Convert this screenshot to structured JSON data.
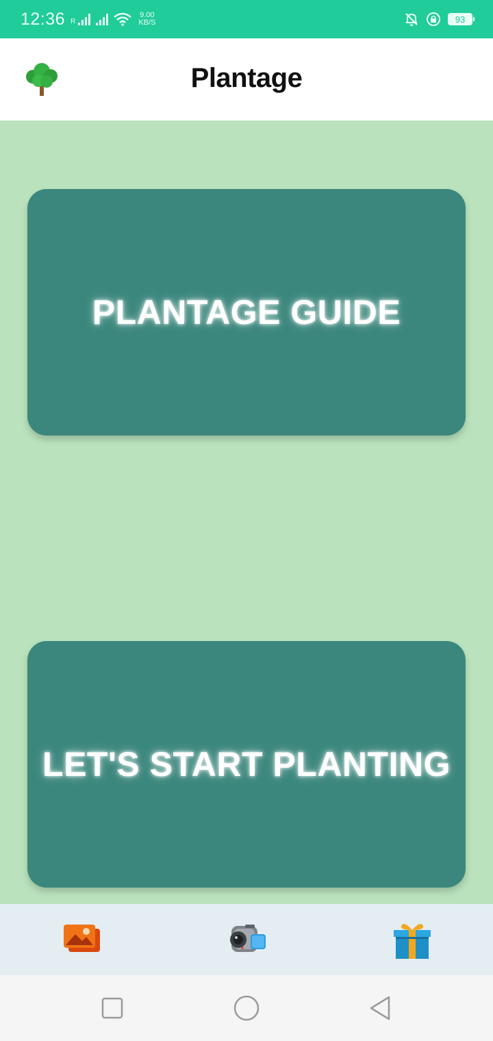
{
  "status_bar": {
    "time": "12:36",
    "signal_r": "R",
    "net_speed_value": "9.00",
    "net_speed_unit": "KB/S",
    "battery": "93"
  },
  "app_bar": {
    "title": "Plantage",
    "logo_icon": "tree-icon"
  },
  "cards": {
    "guide_label": "PLANTAGE GUIDE",
    "start_label": "LET'S START PLANTING"
  },
  "bottom_nav": {
    "items": [
      {
        "icon": "gallery-icon"
      },
      {
        "icon": "video-camera-icon"
      },
      {
        "icon": "gift-icon"
      }
    ]
  },
  "system_nav": {
    "items": [
      {
        "icon": "recents-square-icon"
      },
      {
        "icon": "home-circle-icon"
      },
      {
        "icon": "back-triangle-icon"
      }
    ]
  },
  "colors": {
    "status_bar": "#20cc9a",
    "background": "#bae3bd",
    "card": "#3b877d",
    "bottom_nav": "#e4edf2"
  }
}
